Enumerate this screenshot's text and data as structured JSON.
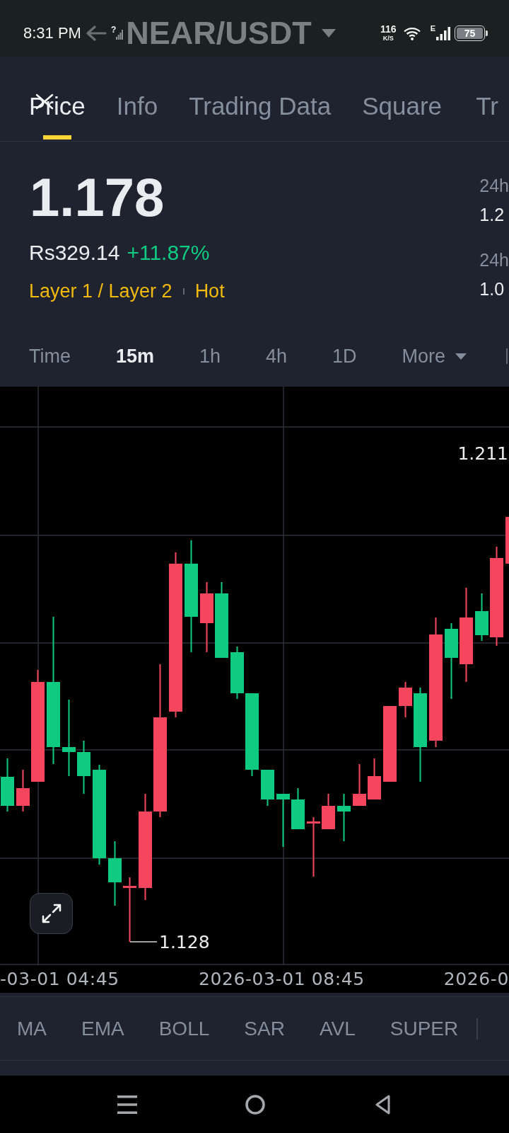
{
  "status_bar": {
    "time": "8:31 PM",
    "sim_status": "?",
    "network_speed": "116",
    "network_speed_unit": "K/S",
    "network_type": "E",
    "battery": "75"
  },
  "header": {
    "title": "NEAR/USDT"
  },
  "tabs": [
    {
      "label": "Price",
      "selected": true
    },
    {
      "label": "Info",
      "selected": false
    },
    {
      "label": "Trading Data",
      "selected": false
    },
    {
      "label": "Square",
      "selected": false
    },
    {
      "label": "Tr",
      "selected": false
    }
  ],
  "price": {
    "last": "1.178",
    "fiat_value": "Rs329.14",
    "change": "+11.87%",
    "tags": [
      "Layer 1 / Layer 2",
      "Hot"
    ],
    "stats": [
      {
        "label": "24h",
        "value": "1.2"
      },
      {
        "label": "24h",
        "value": "1.0"
      }
    ]
  },
  "intervals": [
    {
      "label": "Time",
      "kind": "option",
      "selected": false
    },
    {
      "label": "15m",
      "kind": "option",
      "selected": true
    },
    {
      "label": "1h",
      "kind": "option",
      "selected": false
    },
    {
      "label": "4h",
      "kind": "option",
      "selected": false
    },
    {
      "label": "1D",
      "kind": "option",
      "selected": false
    },
    {
      "label": "More",
      "kind": "menu",
      "selected": false
    }
  ],
  "chart": {
    "high_label": "1.211",
    "low_label": "1.128",
    "time_labels": [
      "-03-01 04:45",
      "2026-03-01 08:45",
      "2026-0"
    ]
  },
  "indicators": [
    {
      "label": "MA",
      "selected": false
    },
    {
      "label": "EMA",
      "selected": false
    },
    {
      "label": "BOLL",
      "selected": false
    },
    {
      "label": "SAR",
      "selected": false
    },
    {
      "label": "AVL",
      "selected": false
    },
    {
      "label": "SUPER",
      "selected": false
    }
  ]
}
